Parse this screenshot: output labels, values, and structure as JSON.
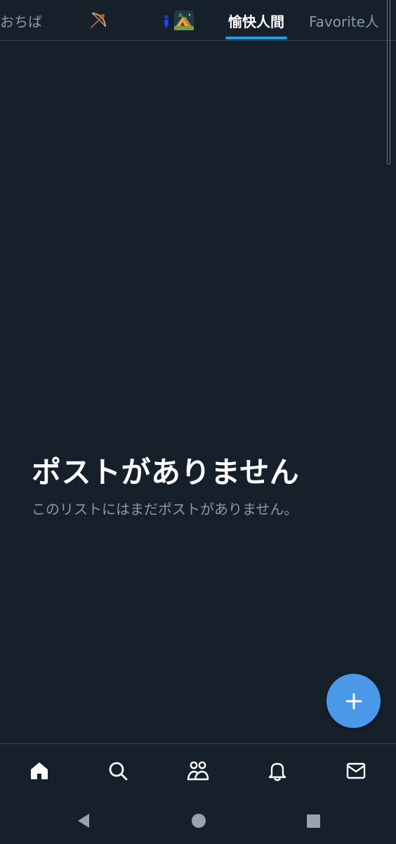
{
  "tabs": [
    {
      "label": "おちば",
      "active": false
    },
    {
      "label": "",
      "icon": "bow-and-arrow-icon",
      "active": false
    },
    {
      "label": "",
      "icon": "person-and-camping-emoji-icon",
      "active": false
    },
    {
      "label": "愉快人間",
      "active": true
    },
    {
      "label": "Favorite人",
      "active": false
    }
  ],
  "empty_state": {
    "title": "ポストがありません",
    "subtitle": "このリストにはまだポストがありません。"
  },
  "fab": {
    "icon": "plus-icon"
  },
  "bottom_nav": [
    {
      "icon": "home-icon",
      "active": true
    },
    {
      "icon": "search-icon",
      "active": false
    },
    {
      "icon": "communities-icon",
      "active": false
    },
    {
      "icon": "bell-icon",
      "active": false
    },
    {
      "icon": "mail-icon",
      "active": false
    }
  ],
  "system_nav": [
    "back-icon",
    "home-circle-icon",
    "recents-icon"
  ],
  "colors": {
    "background": "#15202b",
    "accent": "#1d9bf0",
    "fab": "#4a99e9",
    "muted_text": "#8b98a5",
    "divider": "#38444d"
  }
}
